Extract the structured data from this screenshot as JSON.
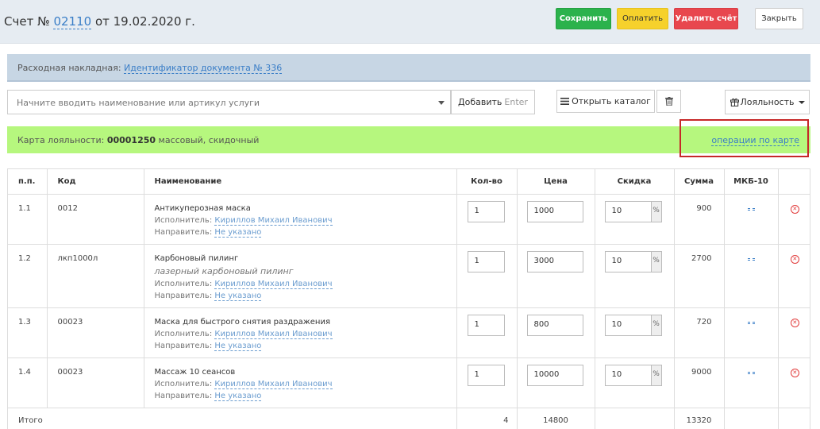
{
  "header": {
    "title_prefix": "Счет №",
    "number": "02110",
    "title_suffix": "от 19.02.2020 г.",
    "save_label": "Сохранить",
    "pay_label": "Оплатить",
    "delete_label": "Удалить счёт",
    "close_label": "Закрыть"
  },
  "document": {
    "label": "Расходная накладная:",
    "link": "Идентификатор документа № 336"
  },
  "toolbar": {
    "search_placeholder": "Начните вводить наименование или артикул услуги",
    "add_label": "Добавить",
    "add_hint": "Enter",
    "catalog_label": "Открыть каталог",
    "loyalty_label": "Лояльность"
  },
  "loyalty": {
    "label": "Карта лояльности:",
    "card_number": "00001250",
    "card_type": "массовый, скидочный",
    "operations_link": "операции по карте"
  },
  "table": {
    "headers": {
      "num": "п.п.",
      "code": "Код",
      "name": "Наименование",
      "qty": "Кол-во",
      "price": "Цена",
      "discount": "Скидка",
      "sum": "Сумма",
      "mkb": "МКБ-10"
    },
    "performer_label": "Исполнитель:",
    "referrer_label": "Направитель:",
    "percent": "%",
    "rows": [
      {
        "num": "1.1",
        "code": "0012",
        "name": "Антикуперозная маска",
        "note": "",
        "performer": "Кириллов Михаил Иванович",
        "referrer": "Не указано",
        "qty": "1",
        "price": "1000",
        "discount": "10",
        "sum": "900"
      },
      {
        "num": "1.2",
        "code": "лкп1000л",
        "name": "Карбоновый пилинг",
        "note": "лазерный карбоновый пилинг",
        "performer": "Кириллов Михаил Иванович",
        "referrer": "Не указано",
        "qty": "1",
        "price": "3000",
        "discount": "10",
        "sum": "2700"
      },
      {
        "num": "1.3",
        "code": "00023",
        "name": "Маска для быстрого снятия раздражения",
        "note": "",
        "performer": "Кириллов Михаил Иванович",
        "referrer": "Не указано",
        "qty": "1",
        "price": "800",
        "discount": "10",
        "sum": "720"
      },
      {
        "num": "1.4",
        "code": "00023",
        "name": "Массаж 10 сеансов",
        "note": "",
        "performer": "Кириллов Михаил Иванович",
        "referrer": "Не указано",
        "qty": "1",
        "price": "10000",
        "discount": "10",
        "sum": "9000"
      }
    ],
    "total": {
      "label": "Итого",
      "qty": "4",
      "price": "14800",
      "sum": "13320"
    }
  },
  "colors": {
    "save": "#2bb24c",
    "pay": "#f6d12b",
    "delete": "#e8474e",
    "loyalty_bar": "#b6f77e",
    "link": "#3a7ec7",
    "highlight": "#c62828"
  },
  "icons": {
    "catalog": "list-icon",
    "trash": "trash-icon",
    "loyalty": "gift-icon",
    "remove": "remove-circle-icon",
    "mkb": "mkb-edit-icon"
  }
}
